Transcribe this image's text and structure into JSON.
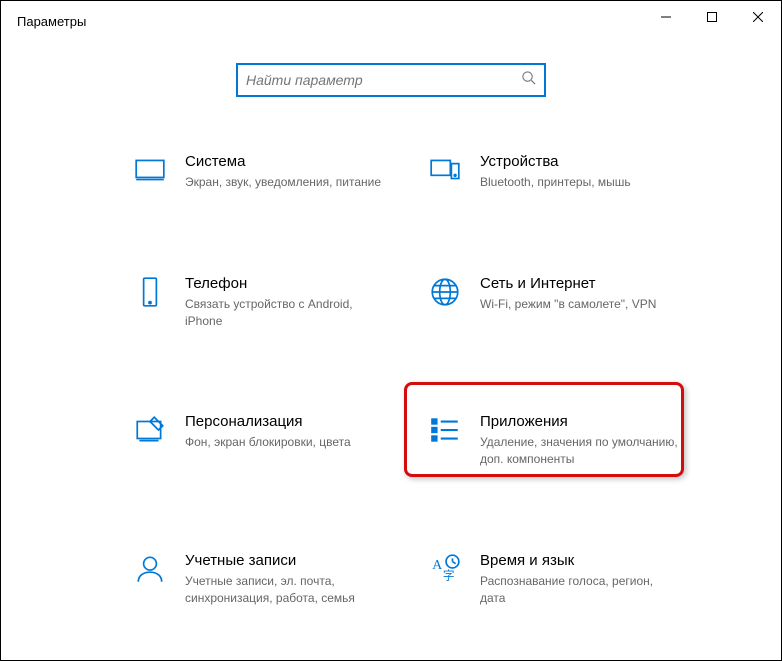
{
  "window": {
    "title": "Параметры"
  },
  "search": {
    "placeholder": "Найти параметр"
  },
  "tiles": {
    "system": {
      "title": "Система",
      "desc": "Экран, звук, уведомления, питание"
    },
    "devices": {
      "title": "Устройства",
      "desc": "Bluetooth, принтеры, мышь"
    },
    "phone": {
      "title": "Телефон",
      "desc": "Связать устройство с Android, iPhone"
    },
    "network": {
      "title": "Сеть и Интернет",
      "desc": "Wi-Fi, режим \"в самолете\", VPN"
    },
    "personal": {
      "title": "Персонализация",
      "desc": "Фон, экран блокировки, цвета"
    },
    "apps": {
      "title": "Приложения",
      "desc": "Удаление, значения по умолчанию, доп. компоненты"
    },
    "accounts": {
      "title": "Учетные записи",
      "desc": "Учетные записи, эл. почта, синхронизация, работа, семья"
    },
    "time": {
      "title": "Время и язык",
      "desc": "Распознавание голоса, регион, дата"
    }
  }
}
